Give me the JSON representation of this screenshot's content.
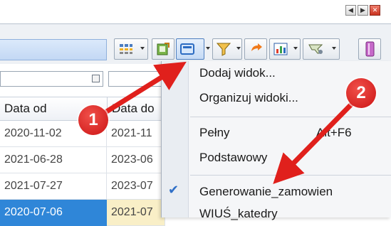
{
  "window_controls": {
    "prev_icon": "arrow-left-icon",
    "next_icon": "arrow-right-icon",
    "close_icon": "close-icon"
  },
  "toolbar": {
    "icons": [
      "columns-icon",
      "export-icon",
      "views-icon",
      "filter-icon",
      "refresh-icon",
      "chart-icon",
      "tools-icon",
      "bookmark-icon"
    ]
  },
  "grid": {
    "columns": [
      "Data od",
      "Data do"
    ],
    "rows": [
      {
        "data_od": "2020-11-02",
        "data_do": "2021-11"
      },
      {
        "data_od": "2021-06-28",
        "data_do": "2023-06"
      },
      {
        "data_od": "2021-07-27",
        "data_do": "2023-07"
      },
      {
        "data_od": "2020-07-06",
        "data_do": "2021-07"
      }
    ]
  },
  "menu": {
    "items": [
      {
        "label": "Dodaj widok..."
      },
      {
        "label": "Organizuj widoki..."
      },
      {
        "label": "Pełny",
        "shortcut": "Alt+F6"
      },
      {
        "label": "Podstawowy"
      },
      {
        "label": "Generowanie_zamowien",
        "checked": true
      },
      {
        "label": "WIUŚ_katedry"
      }
    ]
  },
  "annotations": {
    "badge1": "1",
    "badge2": "2"
  },
  "colors": {
    "annotation_red": "#e0201c",
    "selection_blue": "#2f86d8",
    "check_blue": "#2f6fc7"
  }
}
